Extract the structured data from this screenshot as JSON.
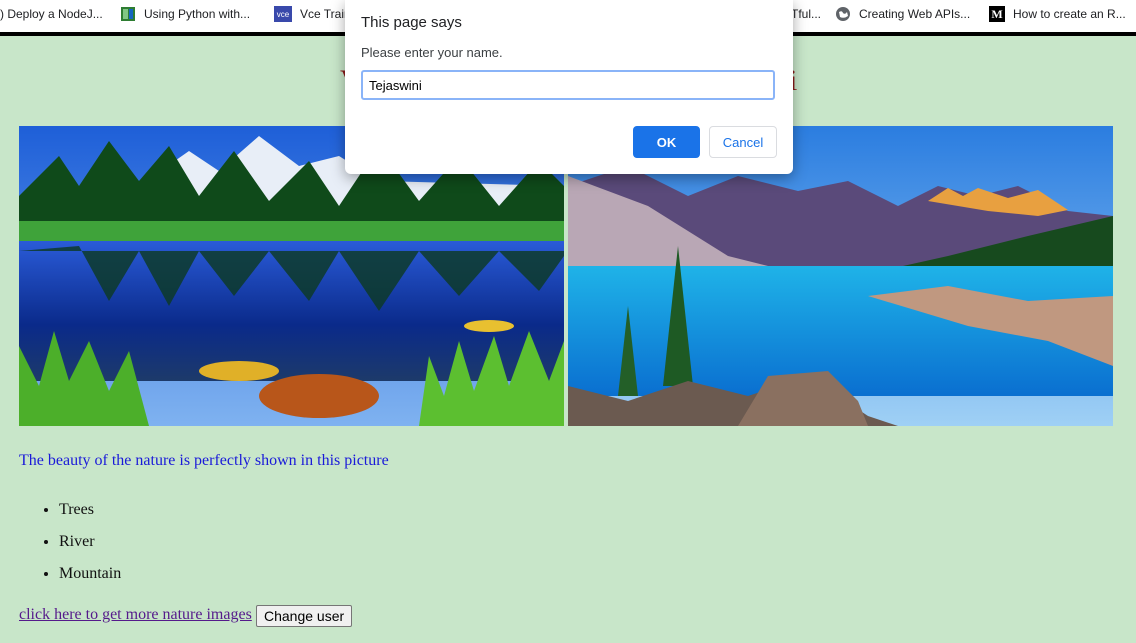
{
  "bookmarks": [
    {
      "label": ") Deploy a NodeJ...",
      "icon": "none"
    },
    {
      "label": "Using Python with...",
      "icon": "book-icon"
    },
    {
      "label": "Vce Trair",
      "icon": "vce-icon",
      "icon_text": "vce"
    },
    {
      "label": "Tful...",
      "icon": "none"
    },
    {
      "label": "Creating Web APIs...",
      "icon": "globe-icon"
    },
    {
      "label": "How to create an R...",
      "icon": "medium-icon",
      "icon_text": "M"
    }
  ],
  "page": {
    "heading_left": "V",
    "heading_right": "i",
    "caption": "The beauty of the nature is perfectly shown in this picture",
    "list_items": [
      "Trees",
      "River",
      "Mountain"
    ],
    "link_text": "click here to get more nature images",
    "change_user_label": "Change user"
  },
  "dialog": {
    "title": "This page says",
    "message": "Please enter your name.",
    "input_value": "Tejaswini",
    "ok_label": "OK",
    "cancel_label": "Cancel"
  },
  "colors": {
    "page_background": "#c8e6c9",
    "caption_text": "#1a1ad9",
    "link_text": "#551a8b",
    "ok_button": "#1a73e8"
  }
}
